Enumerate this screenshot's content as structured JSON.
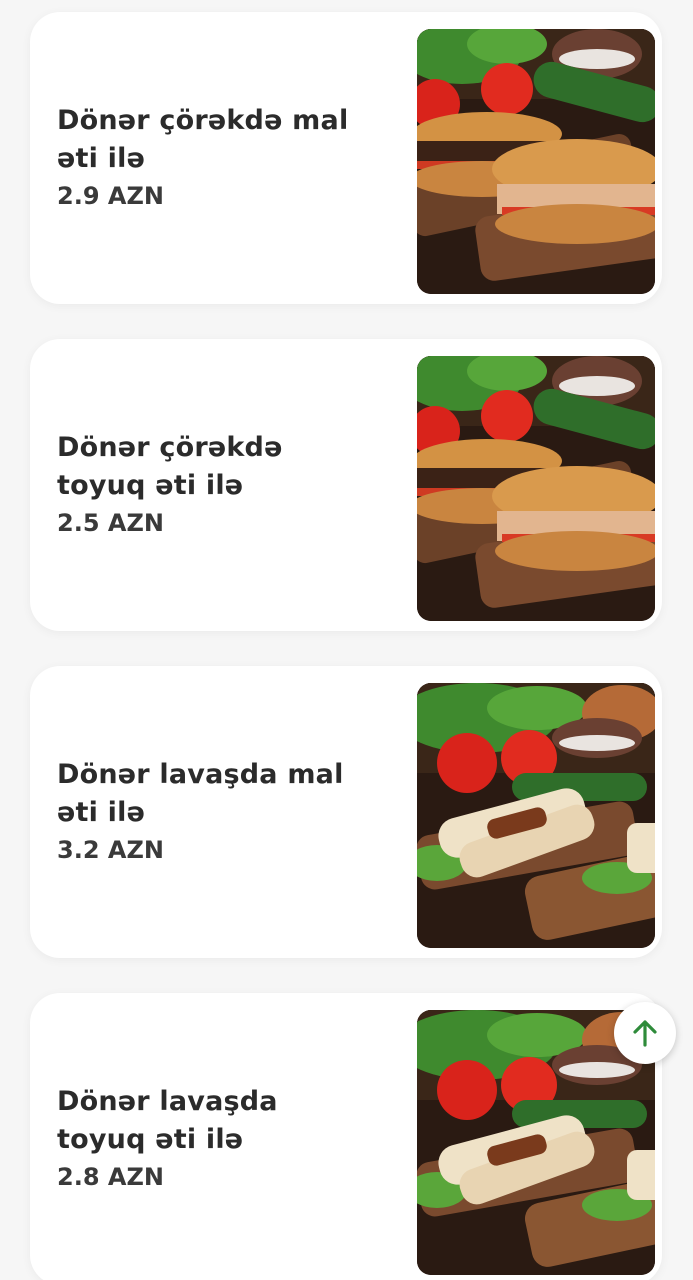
{
  "menu": {
    "items": [
      {
        "title": "Dönər çörəkdə mal əti ilə",
        "title_lines": [
          "Dönər çörəkdə mal",
          "əti ilə"
        ],
        "price": "2.9 AZN",
        "photo": "doner-bread-sandwich-photo"
      },
      {
        "title": "Dönər çörəkdə toyuq əti ilə",
        "title_lines": [
          "Dönər çörəkdə",
          "toyuq əti ilə"
        ],
        "price": "2.5 AZN",
        "photo": "doner-bread-sandwich-photo"
      },
      {
        "title": "Dönər lavaşda mal əti ilə",
        "title_lines": [
          "Dönər lavaşda mal",
          "əti ilə"
        ],
        "price": "3.2 AZN",
        "photo": "doner-lavash-wrap-photo"
      },
      {
        "title": "Dönər lavaşda toyuq əti ilə",
        "title_lines": [
          "Dönər lavaşda",
          "toyuq əti ilə"
        ],
        "price": "2.8 AZN",
        "photo": "doner-lavash-wrap-photo"
      }
    ]
  },
  "scroll_top_button": {
    "icon": "arrow-up-icon",
    "color": "#2e8b3a"
  },
  "colors": {
    "background": "#f6f6f6",
    "card": "#ffffff",
    "text": "#2b2b2b"
  }
}
